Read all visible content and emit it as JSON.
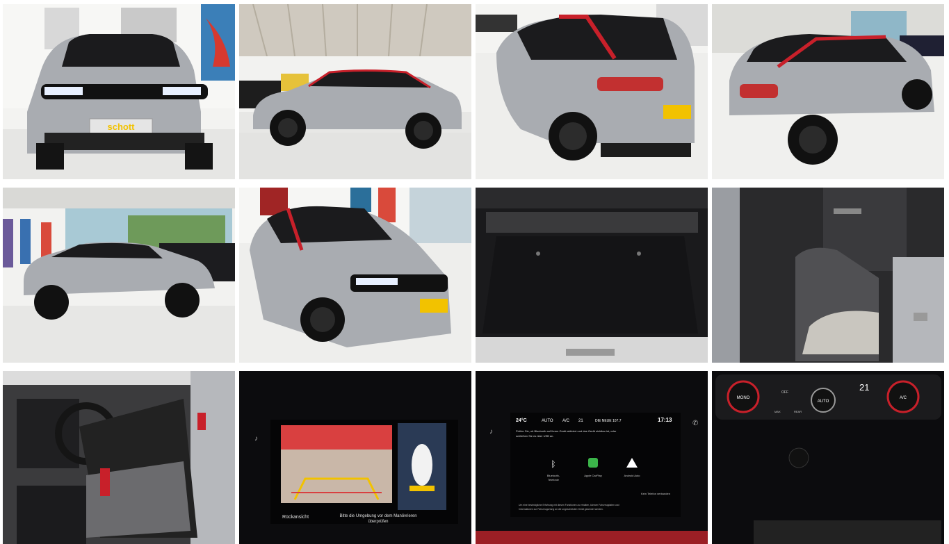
{
  "gallery": {
    "plate_text": "schott",
    "rear_camera_label": "Rückansicht",
    "rear_camera_hint_1": "Bitte die Umgebung vor dem Manövrieren",
    "rear_camera_hint_2": "überprüfen",
    "infotainment": {
      "temperature": "24°C",
      "auto": "AUTO",
      "ac": "A/C",
      "fan": "21",
      "station": "DIE NEUE 107.7",
      "clock": "17:13",
      "message_1": "Prüfen Sie, ob Bluetooth auf Ihrem Gerät aktiviert und das Gerät sichtbar ist, oder",
      "message_2": "schließen Sie es über USB an.",
      "bluetooth_label_1": "Bluetooth-",
      "bluetooth_label_2": "Telefonie",
      "carplay_label": "Apple CarPlay",
      "android_label": "Android Auto",
      "no_phone": "Kein Telefon verbunden",
      "footer_1": "Um eine bestmögliche Erfahrung mit diesen Funktionen zu erhalten, können Fahrzeugdaten und",
      "footer_2": "Informationen zur Fahrzeugortung an die ungeschützten Gerät gesendet werden."
    },
    "climate": {
      "mono": "MONO",
      "auto": "AUTO",
      "ac": "A/C",
      "off": "OFF",
      "temp": "21",
      "max": "MAX",
      "rear": "REAR"
    }
  },
  "colors": {
    "car_silver": "#a9acb1",
    "roof_black": "#1b1b1d",
    "accent_red": "#c8202a",
    "floor_tile": "#e9e9e7",
    "screen_black": "#0c0c0e",
    "plate_yellow": "#f2c200"
  }
}
